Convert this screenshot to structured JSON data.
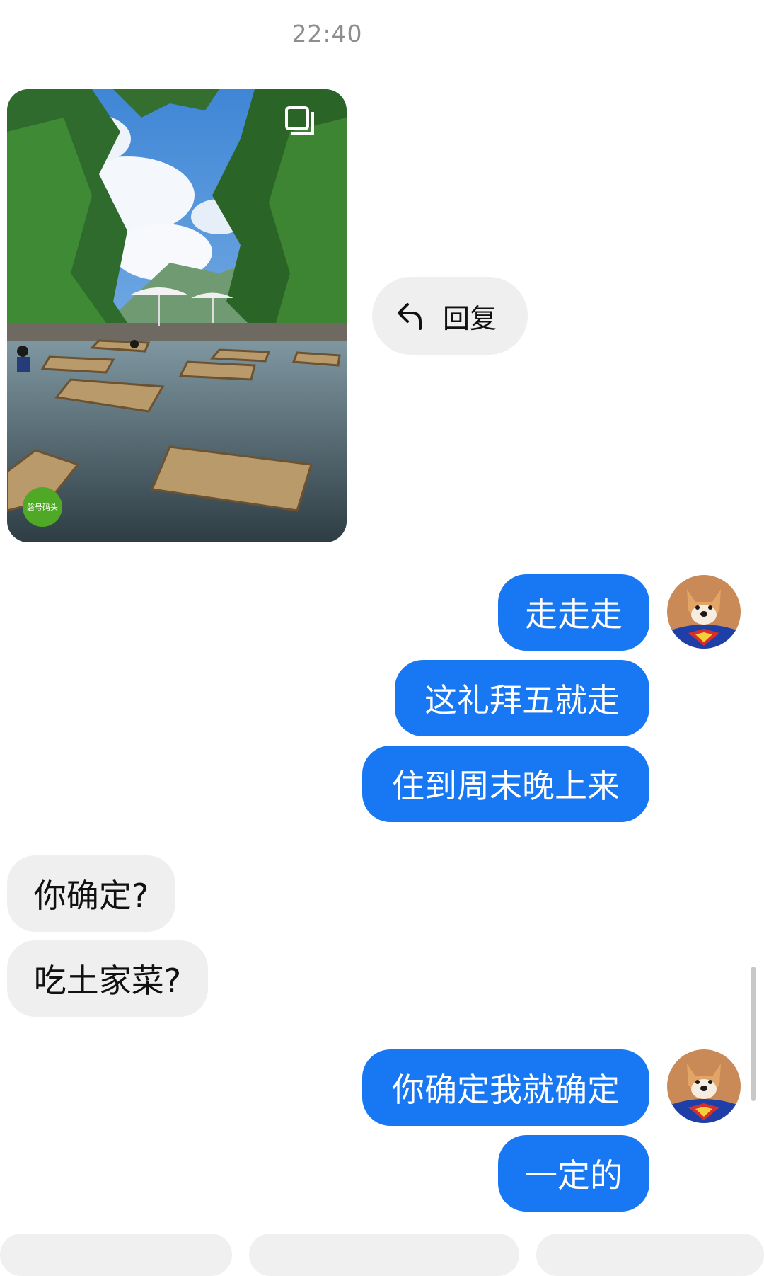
{
  "timestamp": "22:40",
  "shared_post": {
    "image_alt": "river with bamboo platforms in the water, umbrellas, forest and mountains",
    "multi_image_icon": "carousel-icon",
    "logo_badge_text": "磐号码头"
  },
  "reply": {
    "label": "回复",
    "icon": "reply-arrow-icon"
  },
  "messages": [
    {
      "from": "me",
      "text": "走走走"
    },
    {
      "from": "me",
      "text": "这礼拜五就走"
    },
    {
      "from": "me",
      "text": "住到周末晚上来"
    },
    {
      "from": "them",
      "text": "你确定?"
    },
    {
      "from": "them",
      "text": "吃土家菜?"
    },
    {
      "from": "me",
      "text": "你确定我就确定"
    },
    {
      "from": "me",
      "text": "一定的"
    }
  ],
  "colors": {
    "outgoing_bubble": "#1877f2",
    "incoming_bubble": "#efefef",
    "timestamp": "#8e8e8e"
  }
}
